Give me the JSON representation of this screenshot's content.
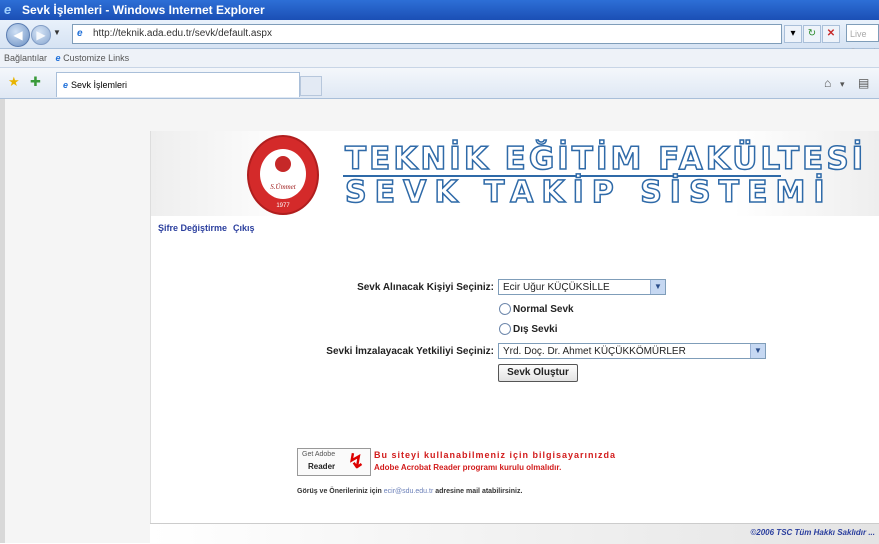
{
  "window": {
    "title": "Sevk İşlemleri - Windows Internet Explorer"
  },
  "browser": {
    "url": "http://teknik.ada.edu.tr/sevk/default.aspx",
    "search_placeholder": "Live Search",
    "links_label": "Bağlantılar",
    "customize_links": "Customize Links",
    "tab_title": "Sevk İşlemleri"
  },
  "header": {
    "line1": "TEKNİK EĞİTİM FAKÜLTESİ",
    "line2": "SEVK TAKİP SİSTEMİ",
    "seal_text": "S.Ümmet",
    "seal_year": "1977"
  },
  "nav": {
    "change_password": "Şifre Değiştirme",
    "logout": "Çıkış"
  },
  "form": {
    "person_label": "Sevk Alınacak Kişiyi Seçiniz:",
    "person_value": "Ecir Uğur KÜÇÜKSİLLE",
    "normal_label": "Normal Sevk",
    "external_label": "Dış Sevki",
    "signer_label": "Sevki İmzalayacak Yetkiliyi Seçiniz:",
    "signer_value": "Yrd. Doç. Dr. Ahmet KÜÇÜKKÖMÜRLER",
    "submit_label": "Sevk Oluştur"
  },
  "adobe": {
    "badge_top": "Get Adobe",
    "badge_bottom": "Reader",
    "msg1": "Bu siteyi kullanabilmeniz için bilgisayarınızda",
    "msg2": "Adobe Acrobat Reader programı kurulu olmalıdır."
  },
  "contact": {
    "prefix": "Görüş ve Önerileriniz için",
    "email": "ecir@sdu.edu.tr",
    "suffix": "adresine mail atabilirsiniz."
  },
  "footer": {
    "copyright": "©2006 TSC Tüm Hakkı Saklıdır ..."
  }
}
